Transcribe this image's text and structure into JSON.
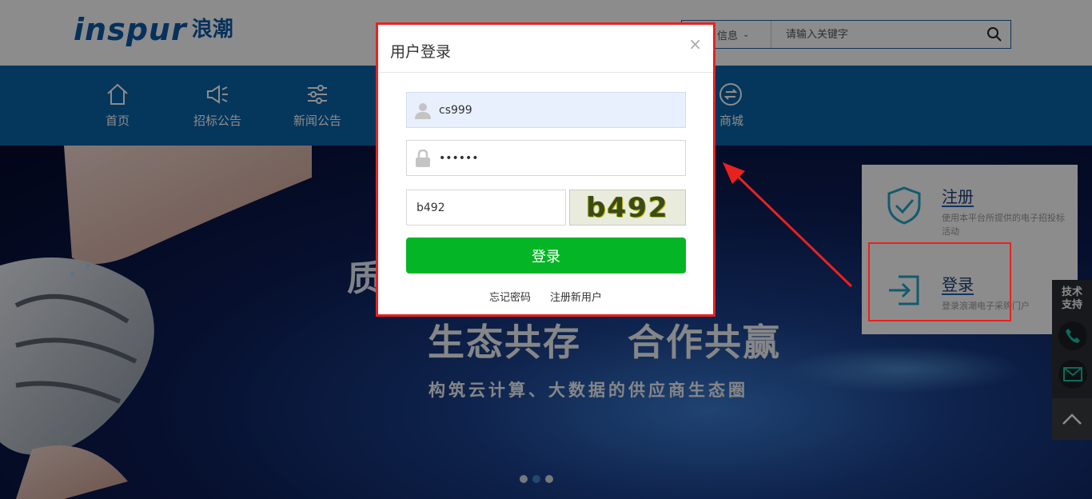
{
  "header": {
    "logo": {
      "brand": "inspur",
      "brand_cn": "浪潮"
    },
    "search": {
      "category": "信息",
      "chevron_icon": "chevron-down-icon",
      "placeholder": "请输入关键字",
      "search_icon": "search-icon"
    }
  },
  "nav": {
    "items": [
      {
        "label": "首页",
        "icon": "home-icon"
      },
      {
        "label": "招标公告",
        "icon": "megaphone-icon"
      },
      {
        "label": "新闻公告",
        "icon": "sliders-icon"
      },
      {
        "label": "商城",
        "icon": "arrows-circle-icon"
      }
    ]
  },
  "hero": {
    "line1": "质",
    "line2": "生态共存 合作共赢",
    "line3": "构筑云计算、大数据的供应商生态圈",
    "carousel_dots": 3,
    "active_dot": 1
  },
  "sidepanel": {
    "register": {
      "title": "注册",
      "desc": "使用本平台所提供的电子招投标活动",
      "icon": "shield-check-icon"
    },
    "login": {
      "title": "登录",
      "desc": "登录浪潮电子采购门户",
      "icon": "login-enter-icon"
    }
  },
  "support": {
    "label_line1": "技术",
    "label_line2": "支持",
    "phone_icon": "phone-icon",
    "mail_icon": "mail-icon",
    "top_icon": "chevron-up-icon"
  },
  "modal": {
    "title": "用户登录",
    "close_icon": "close-icon",
    "username": {
      "value": "cs999",
      "icon": "user-icon"
    },
    "password": {
      "value": "••••••",
      "icon": "lock-icon"
    },
    "captcha": {
      "value": "b492",
      "image_text": "b492"
    },
    "login_label": "登录",
    "forgot_password": "忘记密码",
    "register_new": "注册新用户"
  },
  "colors": {
    "nav_blue": "#0a63a8",
    "login_green": "#04b526",
    "annotation_red": "#e8221f"
  }
}
